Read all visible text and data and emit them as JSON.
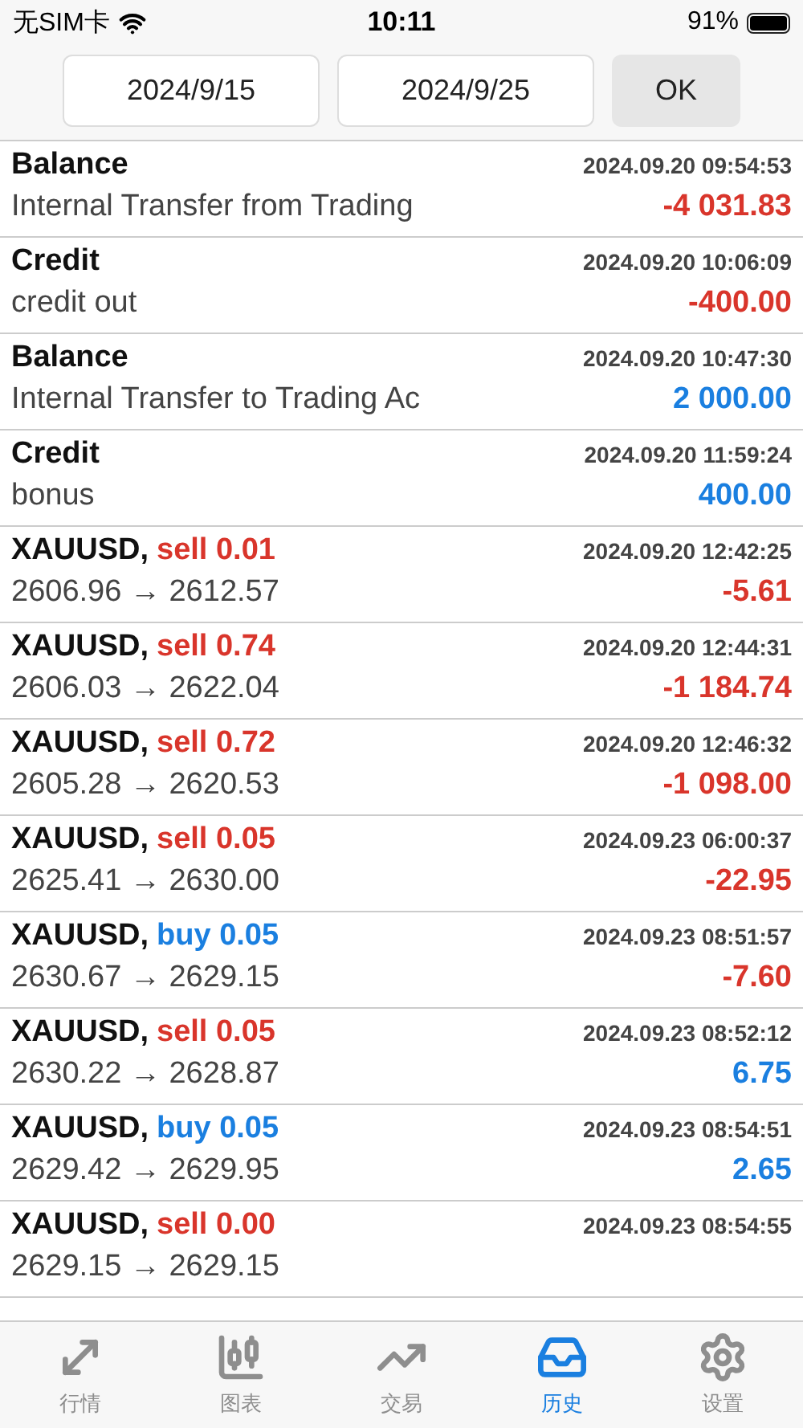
{
  "status_bar": {
    "carrier": "无SIM卡",
    "time": "10:11",
    "battery": "91%"
  },
  "date_range": {
    "from": "2024/9/15",
    "to": "2024/9/25",
    "ok": "OK"
  },
  "rows": [
    {
      "kind": "balance",
      "title": "Balance",
      "detail": "Internal Transfer from Trading",
      "time": "2024.09.20 09:54:53",
      "amount": {
        "text": "-4 031.83",
        "color": "#d9352b"
      }
    },
    {
      "kind": "balance",
      "title": "Credit",
      "detail": "credit out",
      "time": "2024.09.20 10:06:09",
      "amount": {
        "text": "-400.00",
        "color": "#d9352b"
      }
    },
    {
      "kind": "balance",
      "title": "Balance",
      "detail": "Internal Transfer to Trading Ac",
      "time": "2024.09.20 10:47:30",
      "amount": {
        "text": "2 000.00",
        "color": "#1a7fe0"
      }
    },
    {
      "kind": "balance",
      "title": "Credit",
      "detail": "bonus",
      "time": "2024.09.20 11:59:24",
      "amount": {
        "text": "400.00",
        "color": "#1a7fe0"
      }
    },
    {
      "kind": "trade",
      "title": "XAUUSD,",
      "order": {
        "text": "sell 0.01",
        "color": "#d9352b"
      },
      "detail": "2606.96 → 2612.57",
      "time": "2024.09.20 12:42:25",
      "amount": {
        "text": "-5.61",
        "color": "#d9352b"
      }
    },
    {
      "kind": "trade",
      "title": "XAUUSD,",
      "order": {
        "text": "sell 0.74",
        "color": "#d9352b"
      },
      "detail": "2606.03 → 2622.04",
      "time": "2024.09.20 12:44:31",
      "amount": {
        "text": "-1 184.74",
        "color": "#d9352b"
      }
    },
    {
      "kind": "trade",
      "title": "XAUUSD,",
      "order": {
        "text": "sell 0.72",
        "color": "#d9352b"
      },
      "detail": "2605.28 → 2620.53",
      "time": "2024.09.20 12:46:32",
      "amount": {
        "text": "-1 098.00",
        "color": "#d9352b"
      }
    },
    {
      "kind": "trade",
      "title": "XAUUSD,",
      "order": {
        "text": "sell 0.05",
        "color": "#d9352b"
      },
      "detail": "2625.41 → 2630.00",
      "time": "2024.09.23 06:00:37",
      "amount": {
        "text": "-22.95",
        "color": "#d9352b"
      }
    },
    {
      "kind": "trade",
      "title": "XAUUSD,",
      "order": {
        "text": "buy 0.05",
        "color": "#1a7fe0"
      },
      "detail": "2630.67 → 2629.15",
      "time": "2024.09.23 08:51:57",
      "amount": {
        "text": "-7.60",
        "color": "#d9352b"
      }
    },
    {
      "kind": "trade",
      "title": "XAUUSD,",
      "order": {
        "text": "sell 0.05",
        "color": "#d9352b"
      },
      "detail": "2630.22 → 2628.87",
      "time": "2024.09.23 08:52:12",
      "amount": {
        "text": "6.75",
        "color": "#1a7fe0"
      }
    },
    {
      "kind": "trade",
      "title": "XAUUSD,",
      "order": {
        "text": "buy 0.05",
        "color": "#1a7fe0"
      },
      "detail": "2629.42 → 2629.95",
      "time": "2024.09.23 08:54:51",
      "amount": {
        "text": "2.65",
        "color": "#1a7fe0"
      }
    },
    {
      "kind": "trade",
      "title": "XAUUSD,",
      "order": {
        "text": "sell 0.00",
        "color": "#d9352b"
      },
      "detail": "2629.15 → 2629.15",
      "time": "2024.09.23 08:54:55"
    }
  ],
  "tab_bar": [
    {
      "kind": "quotes",
      "label": "行情",
      "selected": false
    },
    {
      "kind": "chart",
      "label": "图表",
      "selected": false
    },
    {
      "kind": "trade",
      "label": "交易",
      "selected": false
    },
    {
      "kind": "history",
      "label": "历史",
      "selected": true
    },
    {
      "kind": "settings",
      "label": "设置",
      "selected": false
    }
  ]
}
